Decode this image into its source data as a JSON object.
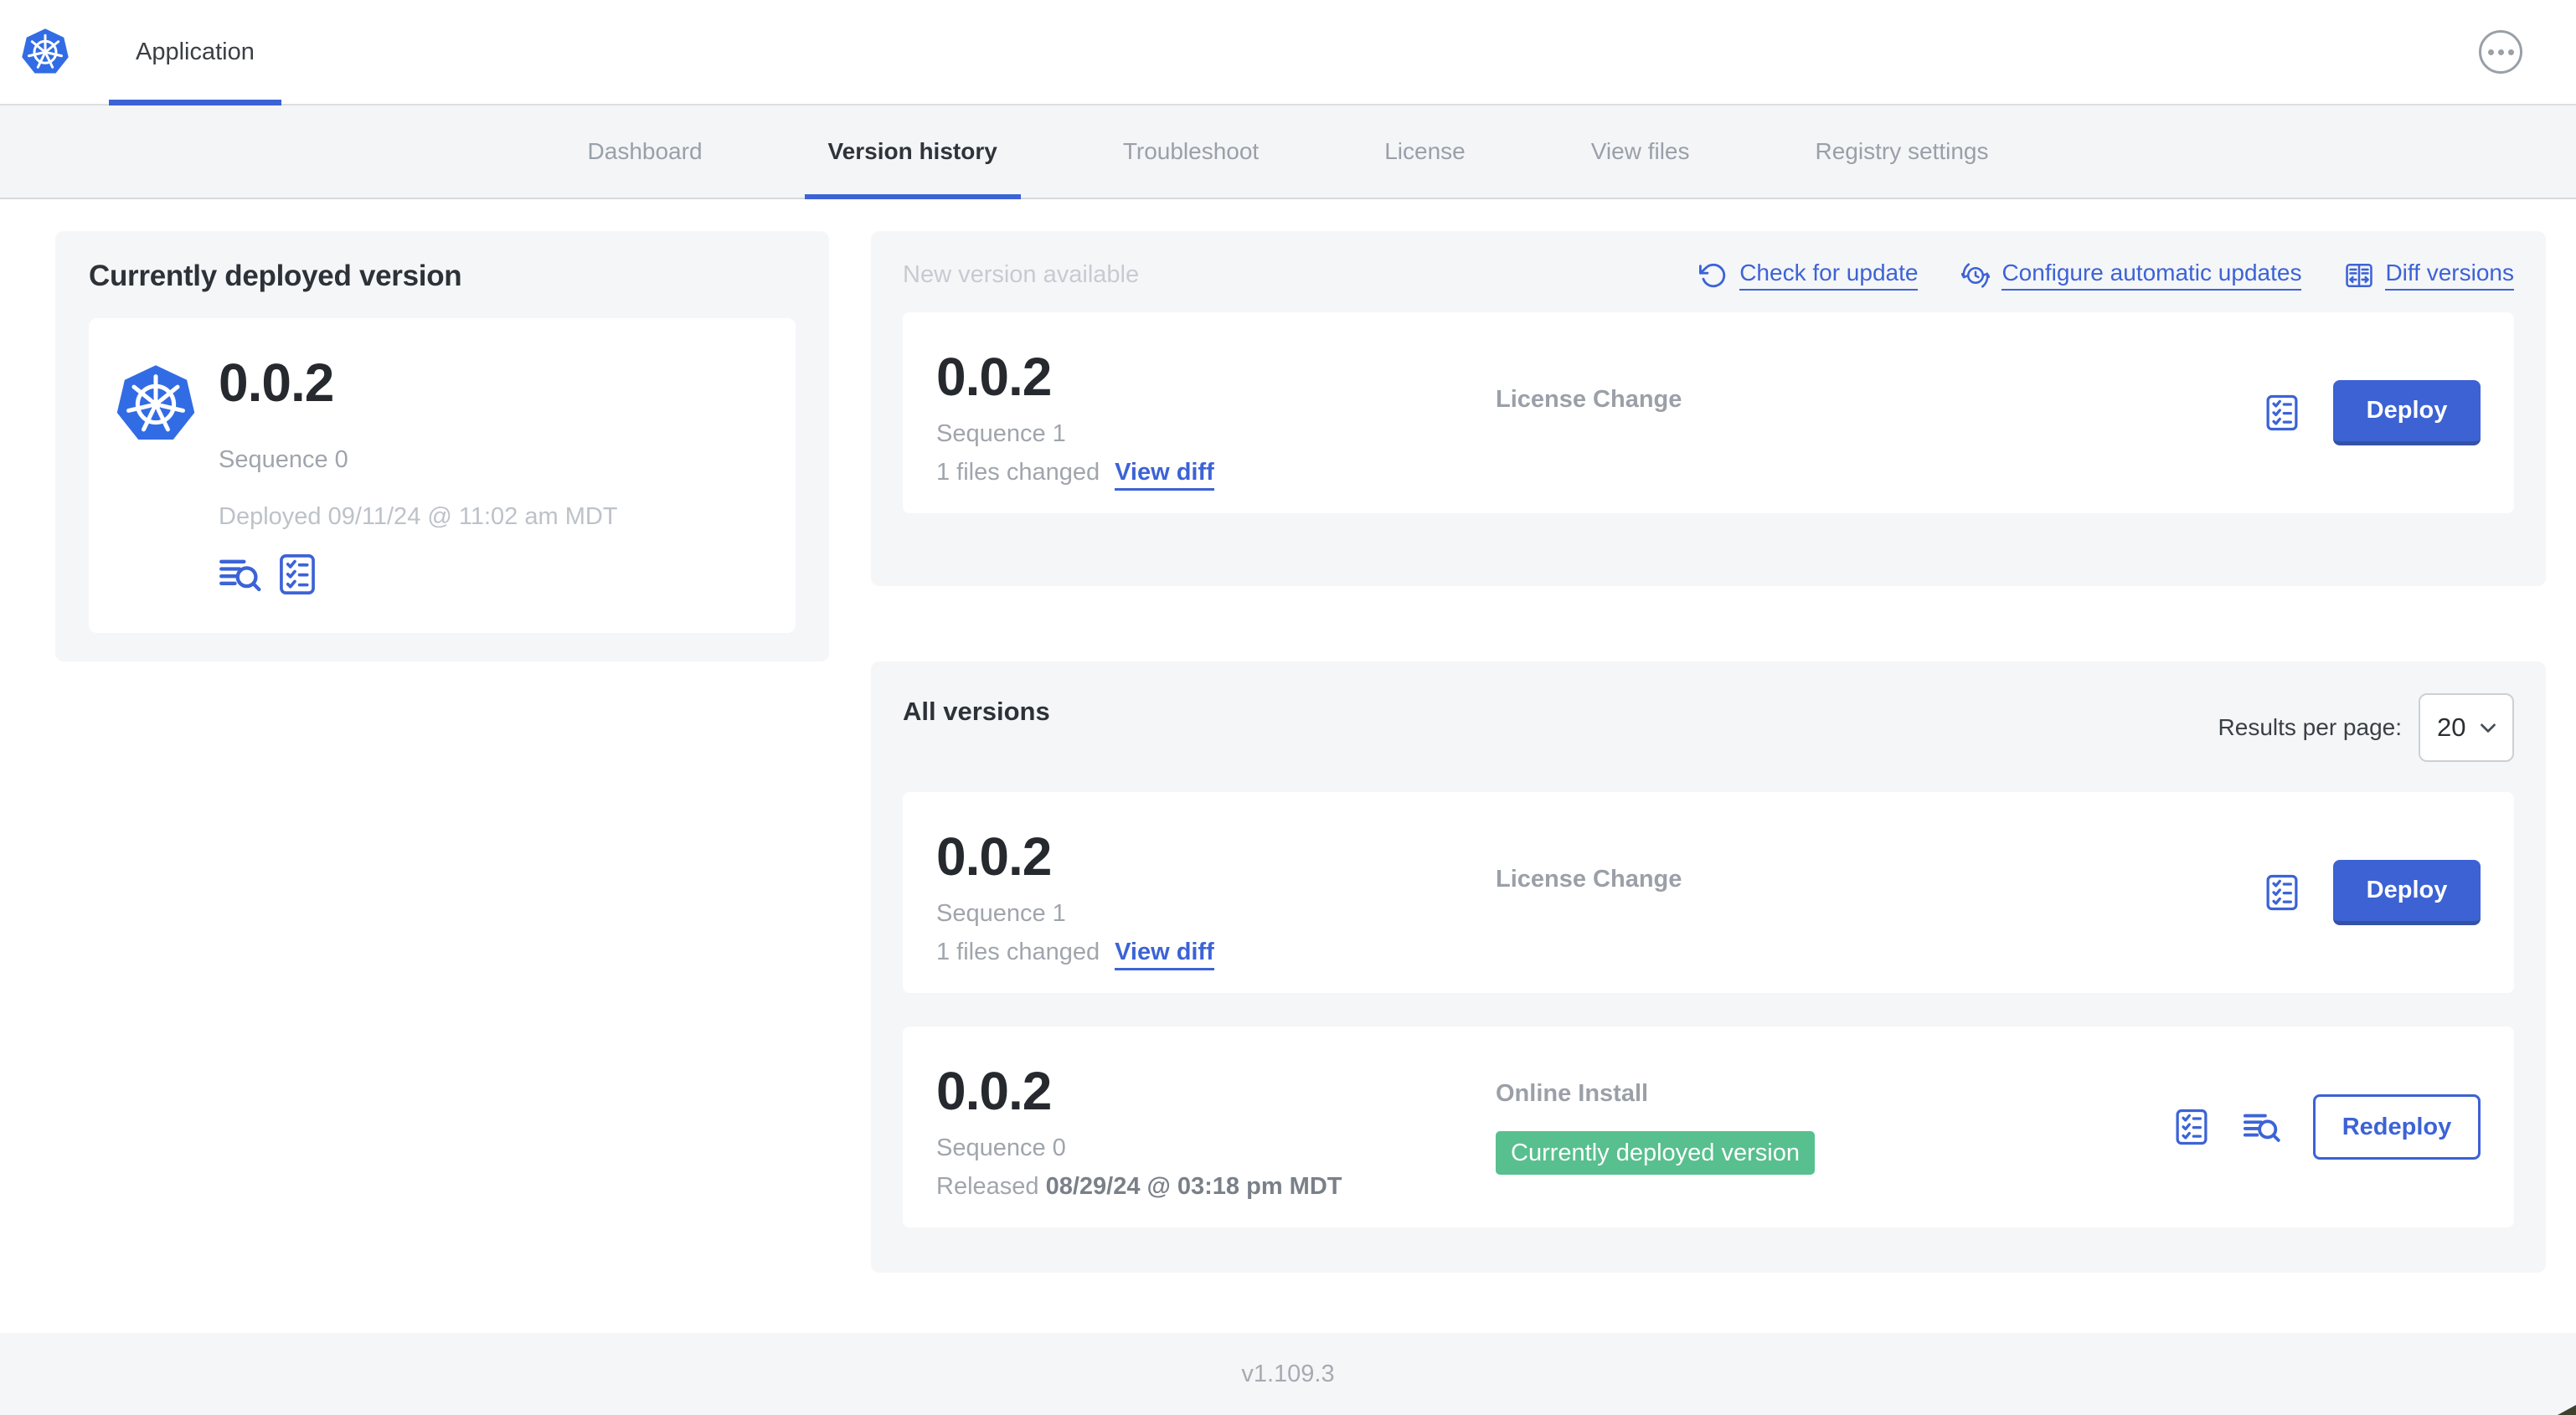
{
  "colors": {
    "accent_blue": "#3c63d6",
    "kubernetes_blue": "#326ce5",
    "badge_green": "#58bf8e",
    "panel_background": "#f5f6f8"
  },
  "header": {
    "title": "Application",
    "more_icon": "ellipsis-circle-icon"
  },
  "nav": {
    "tabs": [
      {
        "label": "Dashboard",
        "active": false
      },
      {
        "label": "Version history",
        "active": true
      },
      {
        "label": "Troubleshoot",
        "active": false
      },
      {
        "label": "License",
        "active": false
      },
      {
        "label": "View files",
        "active": false
      },
      {
        "label": "Registry settings",
        "active": false
      }
    ]
  },
  "current_version": {
    "title": "Currently deployed version",
    "version": "0.0.2",
    "sequence": "Sequence 0",
    "deployed": "Deployed 09/11/24 @ 11:02 am MDT",
    "icons": [
      "logs-icon",
      "checklist-icon"
    ]
  },
  "new_version": {
    "title": "New version available",
    "actions": [
      {
        "label": "Check for update",
        "icon": "refresh-icon"
      },
      {
        "label": "Configure automatic updates",
        "icon": "auto-update-icon"
      },
      {
        "label": "Diff versions",
        "icon": "diff-icon"
      }
    ],
    "card": {
      "version": "0.0.2",
      "sequence": "Sequence 1",
      "files_changed": "1 files changed",
      "view_diff_label": "View diff",
      "source": "License Change",
      "deploy_label": "Deploy"
    }
  },
  "all_versions": {
    "title": "All versions",
    "results_per_page_label": "Results per page:",
    "results_per_page_value": "20",
    "rows": [
      {
        "version": "0.0.2",
        "sequence": "Sequence 1",
        "files_changed": "1 files changed",
        "view_diff_label": "View diff",
        "source": "License Change",
        "action_label": "Deploy"
      },
      {
        "version": "0.0.2",
        "sequence": "Sequence 0",
        "released_label": "Released",
        "released_date": "08/29/24 @ 03:18 pm MDT",
        "source": "Online Install",
        "badge": "Currently deployed version",
        "action_label": "Redeploy"
      }
    ]
  },
  "footer": {
    "app_version": "v1.109.3"
  }
}
